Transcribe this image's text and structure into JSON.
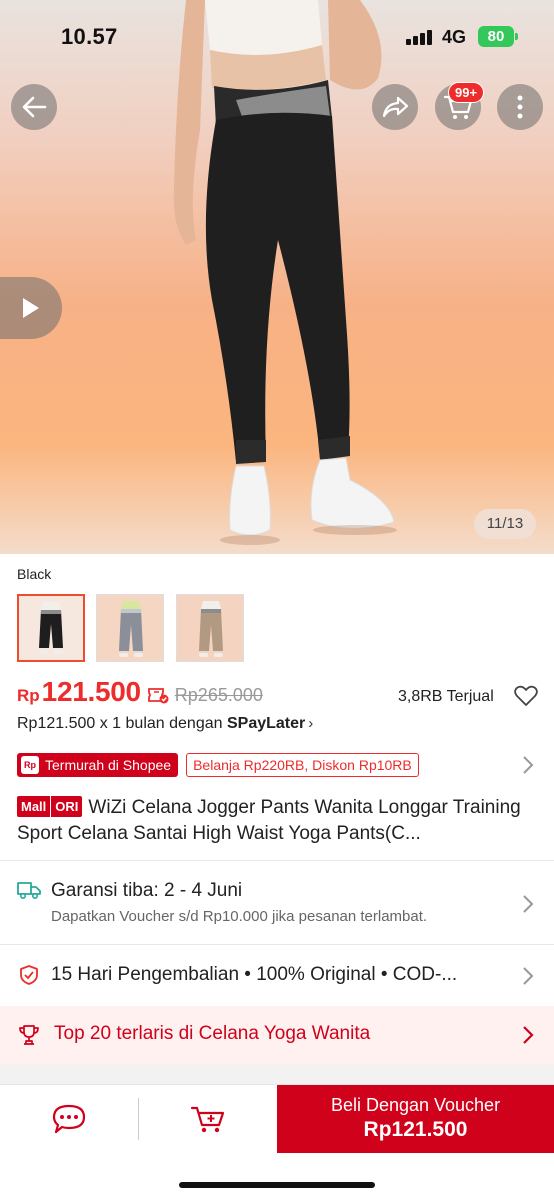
{
  "status_bar": {
    "time": "10.57",
    "network": "4G",
    "battery": "80"
  },
  "gallery": {
    "cart_badge": "99+",
    "page_indicator": "11/13"
  },
  "variants": {
    "selected_label": "Black",
    "options": [
      "Black",
      "Grey",
      "Khaki"
    ]
  },
  "price": {
    "currency": "Rp",
    "current": "121.500",
    "original": "Rp265.000",
    "sold": "3,8RB Terjual",
    "installment_prefix": "Rp121.500 x 1 bulan dengan",
    "installment_brand": "SPayLater"
  },
  "promos": {
    "badge": "Termurah di Shopee",
    "discount": "Belanja Rp220RB, Diskon Rp10RB"
  },
  "product": {
    "badge_mall": "Mall",
    "badge_ori": "ORI",
    "title": "WiZi Celana Jogger Pants Wanita Longgar Training Sport Celana Santai High Waist Yoga Pants(C..."
  },
  "shipping": {
    "main": "Garansi tiba: 2 - 4 Juni",
    "sub": "Dapatkan Voucher s/d Rp10.000 jika pesanan terlambat."
  },
  "guarantee": {
    "text": "15 Hari Pengembalian  •  100% Original  •  COD-..."
  },
  "ranking": {
    "text": "Top 20 terlaris di Celana Yoga Wanita"
  },
  "bottom_bar": {
    "buy_line1": "Beli Dengan Voucher",
    "buy_line2": "Rp121.500"
  },
  "colors": {
    "accent": "#d0011b",
    "price_red": "#ee2c2c",
    "battery": "#34c759"
  },
  "icons": [
    "back-arrow-icon",
    "share-icon",
    "cart-icon",
    "more-icon",
    "play-icon",
    "voucher-icon",
    "heart-icon",
    "truck-icon",
    "shield-icon",
    "trophy-icon",
    "chat-icon",
    "add-cart-icon"
  ]
}
